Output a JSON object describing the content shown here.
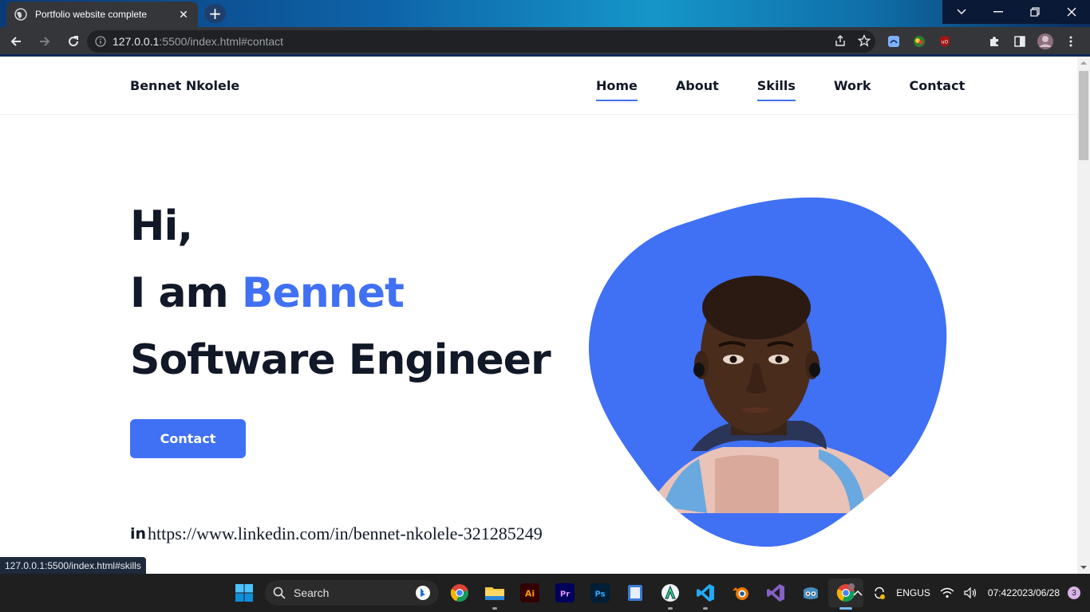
{
  "browser": {
    "tab_title": "Portfolio website complete",
    "url_host": "127.0.0.1",
    "url_rest": ":5500/index.html#contact",
    "status_url": "127.0.0.1:5500/index.html#skills"
  },
  "site": {
    "logo": "Bennet Nkolele",
    "nav": [
      "Home",
      "About",
      "Skills",
      "Work",
      "Contact"
    ],
    "hero": {
      "line1": "Hi,",
      "line2_prefix": "I am ",
      "line2_name": "Bennet",
      "line3": "Software Engineer"
    },
    "contact_button": "Contact",
    "linkedin_url": "https://www.linkedin.com/in/bennet-nkolele-321285249",
    "linkedin_icon_text": "in"
  },
  "taskbar": {
    "search_label": "Search",
    "lang_line1": "ENG",
    "lang_line2": "US",
    "time": "07:42",
    "date": "2023/06/28",
    "notification_count": "3"
  },
  "colors": {
    "accent": "#4070f4",
    "heading": "#111827"
  }
}
